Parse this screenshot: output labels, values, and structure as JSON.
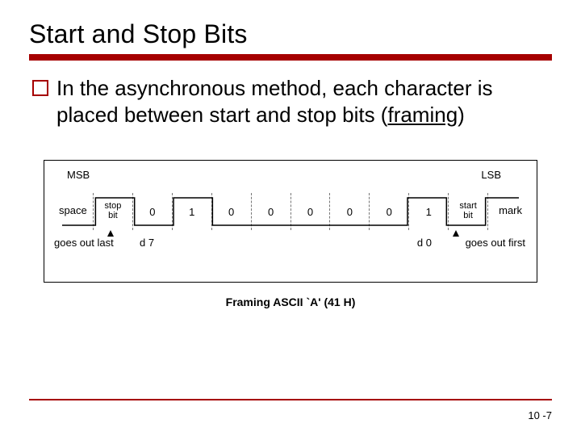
{
  "title": "Start and Stop Bits",
  "body_text_parts": {
    "prefix": "In the asynchronous method, each character is placed between start and stop bits (",
    "underlined": "framing",
    "suffix": ")"
  },
  "diagram": {
    "msb": "MSB",
    "lsb": "LSB",
    "space": "space",
    "mark": "mark",
    "stop_bit": "stop\nbit",
    "start_bit": "start\nbit",
    "bits": [
      "0",
      "1",
      "0",
      "0",
      "0",
      "0",
      "0",
      "1"
    ],
    "goes_out_last": "goes out last",
    "d7": "d 7",
    "d0": "d 0",
    "goes_out_first": "goes out first"
  },
  "caption": "Framing ASCII `A' (41 H)",
  "page_number": "10 -7"
}
